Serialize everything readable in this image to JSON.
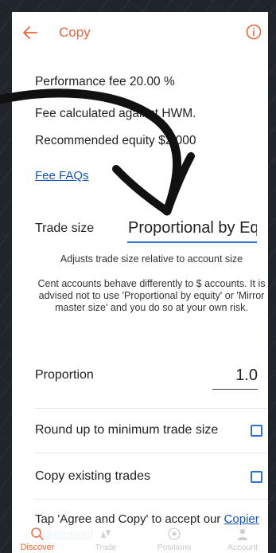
{
  "header": {
    "title": "Copy",
    "back_icon": "arrow-left-icon",
    "info_icon": "info-circle-icon",
    "accent_color": "#e8673c"
  },
  "fees": {
    "performance_fee": "Performance fee 20.00 %",
    "hwm_line": "Fee calculated against HWM.",
    "recommended_equity": "Recommended equity $2,000",
    "fee_faqs_link": "Fee FAQs"
  },
  "trade_size": {
    "label": "Trade size",
    "value": "Proportional by Equity",
    "description": "Adjusts trade size relative to account size",
    "warning": "Cent accounts behave differently to $ accounts. It is advised not to use 'Proportional by equity' or 'Mirror master size' and you do so at your own risk."
  },
  "proportion": {
    "label": "Proportion",
    "value": "1.0"
  },
  "options": {
    "round_up_label": "Round up to minimum trade size",
    "round_up_checked": false,
    "copy_existing_label": "Copy existing trades",
    "copy_existing_checked": false
  },
  "agreement": {
    "text": "Tap 'Agree and Copy' to accept our ",
    "link": "Copier Agreement"
  },
  "bottom_nav": [
    {
      "label": "Discover",
      "icon": "search-icon",
      "active": true
    },
    {
      "label": "Trade",
      "icon": "chart-icon",
      "active": false
    },
    {
      "label": "Positions",
      "icon": "target-icon",
      "active": false
    },
    {
      "label": "Account",
      "icon": "user-icon",
      "active": false
    }
  ],
  "colors": {
    "link": "#1553b8",
    "checkbox": "#2e6fd8",
    "background_frame": "#20242b"
  }
}
